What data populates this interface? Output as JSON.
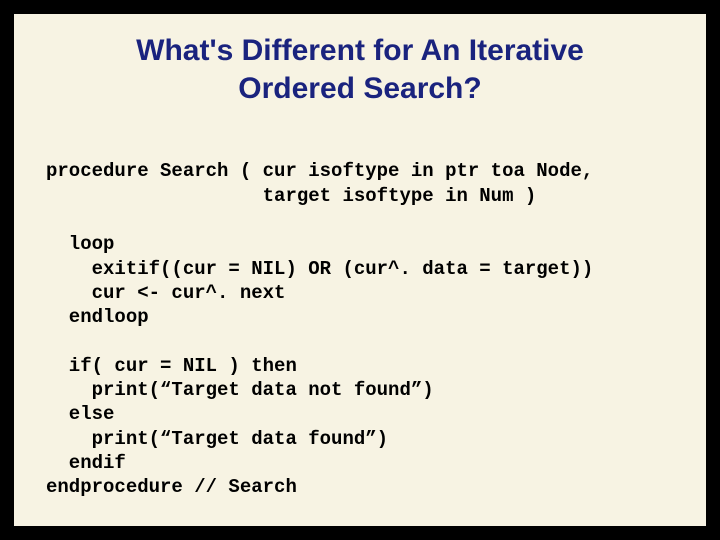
{
  "title_line1": "What's Different for An Iterative",
  "title_line2": "Ordered Search?",
  "code": {
    "l1": "procedure Search ( cur isoftype in ptr toa Node,",
    "l2": "                   target isoftype in Num )",
    "l3": "",
    "l4": "  loop",
    "l5": "    exitif((cur = NIL) OR (cur^. data = target))",
    "l6": "    cur <- cur^. next",
    "l7": "  endloop",
    "l8": "",
    "l9": "  if( cur = NIL ) then",
    "l10": "    print(“Target data not found”)",
    "l11": "  else",
    "l12": "    print(“Target data found”)",
    "l13": "  endif",
    "l14": "endprocedure // Search"
  }
}
